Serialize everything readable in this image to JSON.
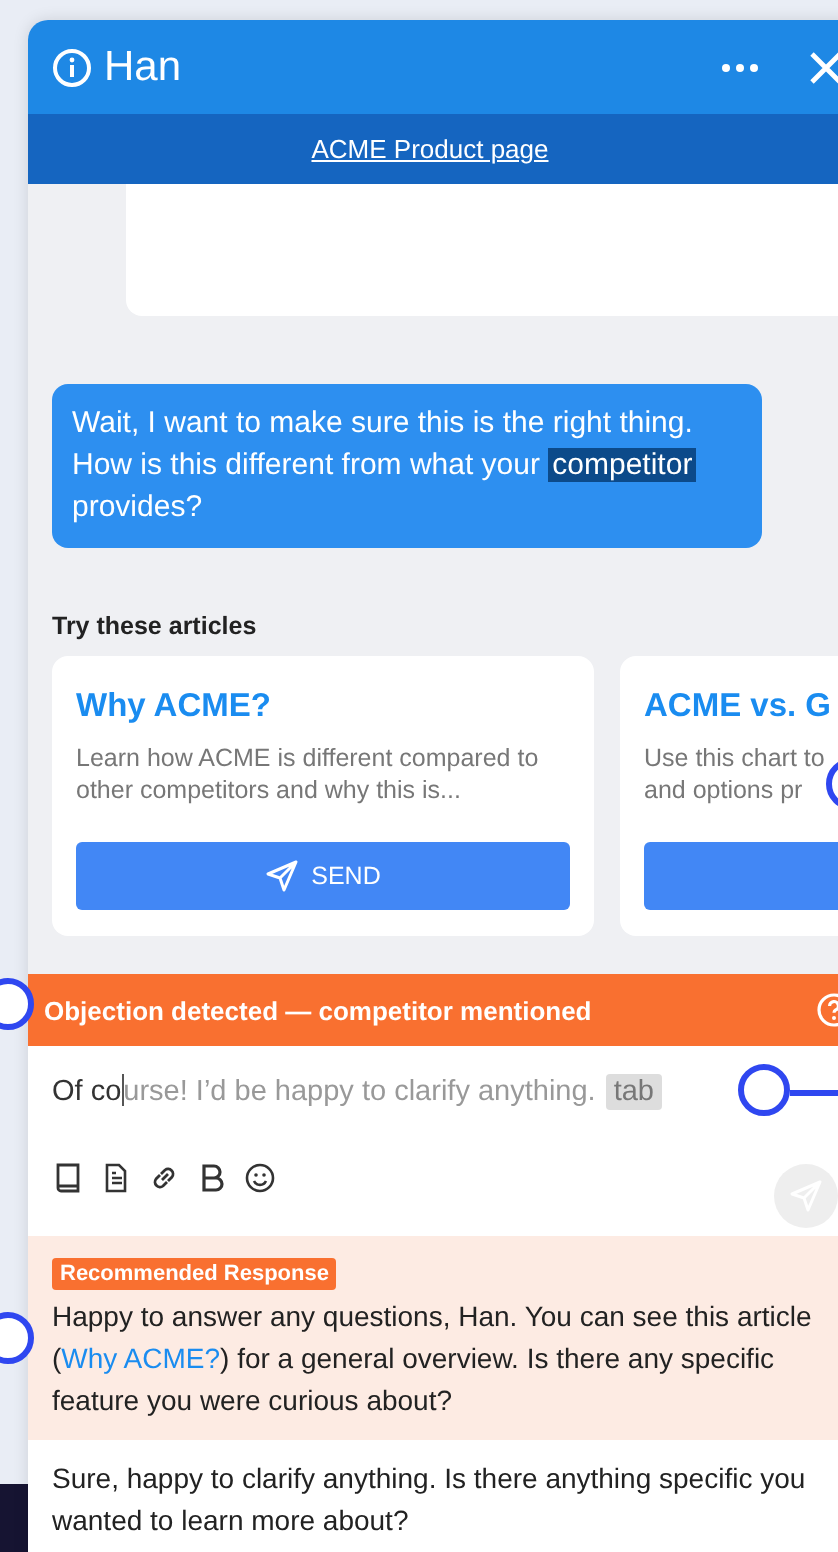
{
  "header": {
    "title": "Han",
    "link": "ACME Product page"
  },
  "customer_message": {
    "parts": [
      {
        "text": "Wait, I want to make sure this is the right thing. How is this different from what your ",
        "highlighted": false
      },
      {
        "text": "competitor",
        "highlighted": true
      },
      {
        "text": "provides?",
        "highlighted": false
      }
    ]
  },
  "articles": {
    "heading": "Try these articles",
    "cards": [
      {
        "title": "Why ACME?",
        "button": "SEND",
        "description_lines": [
          "Learn how ACME is different compared to",
          "other competitors and why this is..."
        ]
      },
      {
        "title": "ACME vs. G",
        "description_lines": [
          "Use this chart to",
          "and options pr"
        ]
      }
    ]
  },
  "alert": {
    "text": "Objection detected — competitor mentioned"
  },
  "composer": {
    "typed": "Of co",
    "suggestion": "urse! I’d be happy to clarify anything.",
    "key_hint": "tab",
    "send_disabled": true
  },
  "recommended": {
    "badge": "Recommended Response",
    "parts": [
      {
        "kind": "text",
        "text": "Happy to answer any questions, Han. You can see this article ("
      },
      {
        "kind": "link",
        "text": "Why ACME?"
      },
      {
        "kind": "text",
        "text": ") for a general overview. Is there any specific feature you were curious about?"
      }
    ]
  },
  "draft": {
    "text": "Sure, happy to clarify anything. Is there anything specific you wanted to learn more about?"
  }
}
